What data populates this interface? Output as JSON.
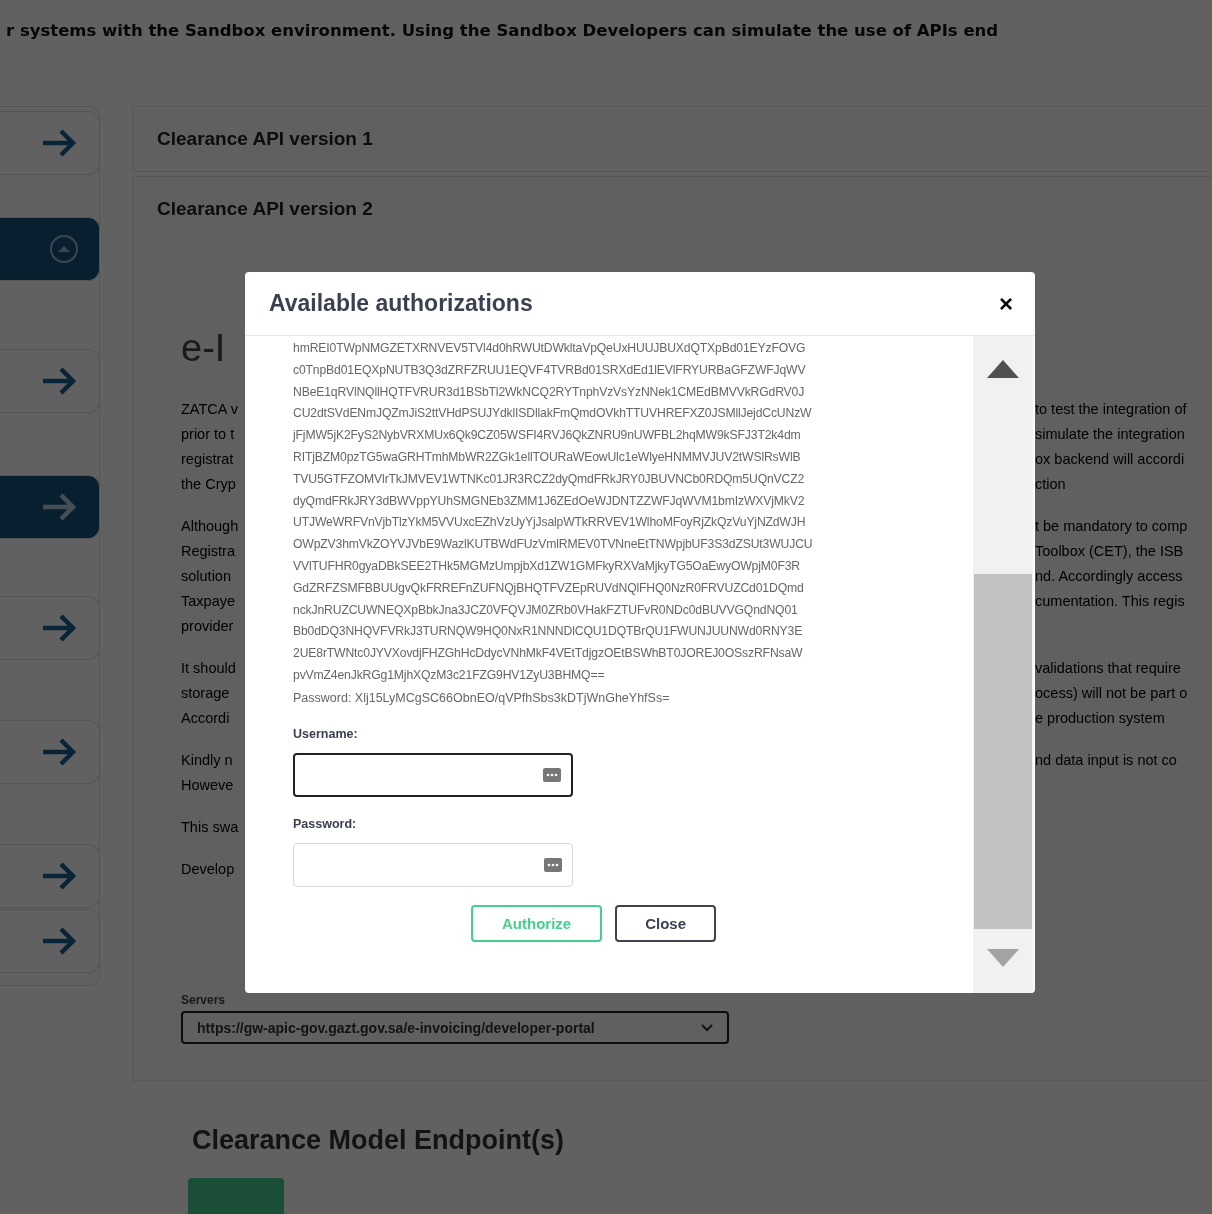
{
  "intro_text": "r systems with the Sandbox environment. Using the Sandbox Developers can simulate the use of APIs end",
  "sidebar": {
    "items": [
      {
        "kind": "arrow",
        "selected": false
      },
      {
        "kind": "collapse",
        "selected": true
      },
      {
        "kind": "arrow",
        "selected": false
      },
      {
        "kind": "arrow",
        "selected": true
      },
      {
        "kind": "arrow",
        "selected": false
      },
      {
        "kind": "arrow",
        "selected": false
      },
      {
        "kind": "arrow",
        "selected": false
      },
      {
        "kind": "arrow",
        "selected": false
      }
    ]
  },
  "accordions": [
    {
      "title": "Clearance API version 1",
      "expanded": false
    },
    {
      "title": "Clearance API version 2",
      "expanded": true,
      "heading": "e-I",
      "paragraphs": [
        {
          "lines": [
            {
              "left": "ZATCA v",
              "right": "to test the integration of"
            },
            {
              "left": "prior to t",
              "right": "simulate the integration"
            },
            {
              "left": "registrat",
              "right": "ox backend will accordi"
            },
            {
              "left": "the Cryp",
              "right": "ction"
            }
          ]
        },
        {
          "lines": [
            {
              "left": "Although",
              "right": "t be mandatory to comp"
            },
            {
              "left": "Registra",
              "right": "Toolbox (CET), the ISB"
            },
            {
              "left": "solution",
              "right": "nd. Accordingly access"
            },
            {
              "left": "Taxpaye",
              "right": "cumentation. This regis"
            },
            {
              "left": "provider"
            }
          ]
        },
        {
          "lines": [
            {
              "left": "It should",
              "right": "validations that require"
            },
            {
              "left": "storage",
              "right": "ocess) will not be part o"
            },
            {
              "left": "Accordi",
              "right": "e production system"
            }
          ]
        },
        {
          "lines": [
            {
              "left": "Kindly n",
              "right": "nd data input is not co"
            },
            {
              "left": "Howeve"
            }
          ]
        },
        {
          "lines": [
            {
              "left": "This swa"
            }
          ]
        },
        {
          "lines": [
            {
              "left": "Develop"
            }
          ]
        }
      ],
      "servers_label": "Servers",
      "server": "https://gw-apic-gov.gazt.gov.sa/e-invoicing/developer-portal"
    }
  ],
  "endpoints_heading": "Clearance Model Endpoint(s)",
  "modal": {
    "title": "Available authorizations",
    "close": "×",
    "credential_lines": [
      "hmREI0TWpNMGZETXRNVEV5TVl4d0hRWUtDWkltaVpQeUxHUUJBUXdQTXpBd01EYzFOVG",
      "c0TnpBd01EQXpNUTB3Q3dZRFZRUU1EQVF4TVRBd01SRXdEd1lEVlFRYURBaGFZWFJqWV",
      "NBeE1qRVlNQllHQTFVRUR3d1BSbTl2WkNCQ2RYTnphVzVsYzNNek1CMEdBMVVkRGdRV0J",
      "CU2dtSVdENmJQZmJiS2ttVHdPSUJYdklISDllakFmQmdOVkhTTUVHREFXZ0JSMllJejdCcUNzW",
      "jFjMW5jK2FyS2NybVRXMUx6Qk9CZ05WSFI4RVJ6QkZNRU9nUWFBL2hqMW9kSFJ3T2k4dm",
      "RITjBZM0pzTG5waGRHTmhMbWR2ZGk1ellTOURaWEowUlc1eWlyeHNMMVJUV2tWSlRsWlB",
      "TVU5GTFZOMVlrTkJMVEV1WTNKc01JR3RCZ2dyQmdFRkJRY0JBUVNCb0RDQm5UQnVCZ2",
      "dyQmdFRkJRY3dBWVppYUhSMGNEb3ZMM1J6ZEdOeWJDNTZZWFJqWVM1bmIzWXVjMkV2",
      "UTJWeWRFVnVjbTlzYkM5VVUxcEZhVzUyYjJsalpWTkRRVEV1WlhoMFoyRjZkQzVuYjNZdWJH",
      "OWpZV3hmVkZOYVJVbE9WazlKUTBWdFUzVmlRMEV0TVNneEtTNWpjbUF3S3dZSUt3WUJCU",
      "VVlTUFHR0gyaDBkSEE2THk5MGMzUmpjbXd1ZW1GMFkyRXVaMjkyTG5OaEwyOWpjM0F3R",
      "GdZRFZSMFBBUUgvQkFRREFnZUFNQjBHQTFVZEpRUVdNQlFHQ0NzR0FRVUZCd01DQmd",
      "nckJnRUZCUWNEQXpBbkJna3JCZ0VFQVJM0ZRb0VHakFZTUFvR0NDc0dBUVVGQndNQ01",
      "Bb0dDQ3NHQVFVRkJ3TURNQW9HQ0NxR1NNNDlCQU1DQTBrQU1FWUNJUUNWd0RNY3E",
      "2UE8rTWNtc0JYVXovdjFHZGhHcDdycVNhMkF4VEtTdjgzOEtBSWhBT0JOREJ0OSszRFNsaW",
      "pvVmZ4enJkRGg1MjhXQzM3c21FZG9HV1ZyU3BHMQ=="
    ],
    "password_line": "Password: Xlj15LyMCgSC66ObnEO/qVPfhSbs3kDTjWnGheYhfSs=",
    "fields": [
      {
        "label": "Username:",
        "focused": true
      },
      {
        "label": "Password:",
        "focused": false
      }
    ],
    "buttons": [
      {
        "label": "Authorize",
        "kind": "primary"
      },
      {
        "label": "Close",
        "kind": "secondary"
      }
    ]
  }
}
